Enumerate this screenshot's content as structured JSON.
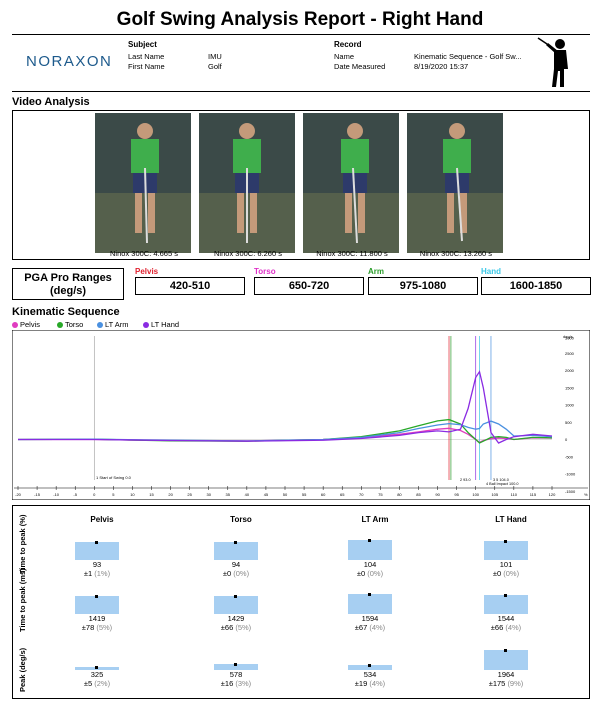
{
  "report": {
    "title": "Golf Swing Analysis Report - Right Hand",
    "logo": "NORAXON",
    "subject_heading": "Subject",
    "subject_last_name_label": "Last Name",
    "subject_last_name": "IMU",
    "subject_first_name_label": "First Name",
    "subject_first_name": "Golf",
    "record_heading": "Record",
    "record_name_label": "Name",
    "record_name": "Kinematic Sequence - Golf Sw...",
    "record_date_label": "Date Measured",
    "record_date": "8/19/2020 15:37"
  },
  "video": {
    "heading": "Video Analysis",
    "frames": [
      {
        "caption": "Ninox 300C: 4.665 s"
      },
      {
        "caption": "Ninox 300C: 6.260 s"
      },
      {
        "caption": "Ninox 300C: 11.800 s"
      },
      {
        "caption": "Ninox 300C: 13.260 s"
      }
    ]
  },
  "pga": {
    "title_line1": "PGA Pro Ranges",
    "title_line2": "(deg/s)",
    "ranges": [
      {
        "label": "Pelvis",
        "value": "420-510",
        "color": "#e0202e"
      },
      {
        "label": "Torso",
        "value": "650-720",
        "color": "#e030c8"
      },
      {
        "label": "Arm",
        "value": "975-1080",
        "color": "#2a9d2a"
      },
      {
        "label": "Hand",
        "value": "1600-1850",
        "color": "#38c8e8"
      }
    ]
  },
  "kinematic": {
    "heading": "Kinematic Sequence",
    "legend": [
      {
        "name": "Pelvis",
        "color": "#e03cc0"
      },
      {
        "name": "Torso",
        "color": "#28a828"
      },
      {
        "name": "LT Arm",
        "color": "#4a90e0"
      },
      {
        "name": "LT Hand",
        "color": "#8a2be2"
      }
    ],
    "unit_label": "deg/s",
    "x_unit": "%",
    "marker_start": "1 Start of Swing 0.0",
    "marker_2": "2  93.0",
    "marker_3": "3  5  104.0",
    "marker_impact": "4  Ball Impact 100.0"
  },
  "chart_data": {
    "type": "line",
    "xlabel": "",
    "ylabel": "deg/s",
    "xlim": [
      -20,
      120
    ],
    "ylim": [
      -1000,
      3000
    ],
    "x": [
      -20,
      0,
      20,
      40,
      60,
      70,
      80,
      85,
      90,
      93,
      96,
      98,
      100,
      101,
      102,
      104,
      106,
      108,
      110,
      115,
      120
    ],
    "series": [
      {
        "name": "Pelvis",
        "values": [
          0,
          0,
          -30,
          -40,
          0,
          60,
          150,
          220,
          300,
          325,
          260,
          150,
          0,
          -80,
          -30,
          20,
          40,
          30,
          0,
          50,
          40
        ]
      },
      {
        "name": "Torso",
        "values": [
          0,
          10,
          -40,
          -50,
          0,
          80,
          250,
          400,
          540,
          578,
          450,
          200,
          0,
          -100,
          -50,
          60,
          80,
          60,
          0,
          60,
          50
        ]
      },
      {
        "name": "LT Arm",
        "values": [
          0,
          10,
          -20,
          -40,
          0,
          60,
          200,
          320,
          420,
          460,
          430,
          350,
          300,
          320,
          450,
          534,
          450,
          300,
          100,
          120,
          80
        ]
      },
      {
        "name": "LT Hand",
        "values": [
          0,
          0,
          -30,
          -50,
          -20,
          30,
          120,
          200,
          250,
          220,
          300,
          900,
          1800,
          1964,
          1500,
          200,
          -100,
          0,
          80,
          150,
          100
        ]
      }
    ],
    "x_ticks": [
      "-20",
      "-15",
      "-10",
      "-5",
      "0",
      "5",
      "10",
      "15",
      "20",
      "25",
      "30",
      "35",
      "40",
      "45",
      "50",
      "55",
      "60",
      "65",
      "70",
      "75",
      "80",
      "85",
      "90",
      "95",
      "100",
      "105",
      "110",
      "115",
      "120"
    ],
    "y_ticks": [
      "3000",
      "2500",
      "2000",
      "1500",
      "1000",
      "500",
      "0",
      "-500",
      "-1000",
      "-1500"
    ]
  },
  "stats": {
    "columns": [
      "Pelvis",
      "Torso",
      "LT Arm",
      "LT Hand"
    ],
    "rows": [
      {
        "label": "Time to peak (%)",
        "cells": [
          {
            "mean": "93",
            "sd": "±1",
            "pct": "(1%)",
            "frac": 0.89
          },
          {
            "mean": "94",
            "sd": "±0",
            "pct": "(0%)",
            "frac": 0.9
          },
          {
            "mean": "104",
            "sd": "±0",
            "pct": "(0%)",
            "frac": 1.0
          },
          {
            "mean": "101",
            "sd": "±0",
            "pct": "(0%)",
            "frac": 0.97
          }
        ]
      },
      {
        "label": "Time to peak (ms)",
        "cells": [
          {
            "mean": "1419",
            "sd": "±78",
            "pct": "(5%)",
            "frac": 0.89
          },
          {
            "mean": "1429",
            "sd": "±66",
            "pct": "(5%)",
            "frac": 0.9
          },
          {
            "mean": "1594",
            "sd": "±67",
            "pct": "(4%)",
            "frac": 1.0
          },
          {
            "mean": "1544",
            "sd": "±66",
            "pct": "(4%)",
            "frac": 0.97
          }
        ]
      },
      {
        "label": "Peak (deg/s)",
        "cells": [
          {
            "mean": "325",
            "sd": "±5",
            "pct": "(2%)",
            "frac": 0.17
          },
          {
            "mean": "578",
            "sd": "±16",
            "pct": "(3%)",
            "frac": 0.29
          },
          {
            "mean": "534",
            "sd": "±19",
            "pct": "(4%)",
            "frac": 0.27
          },
          {
            "mean": "1964",
            "sd": "±175",
            "pct": "(9%)",
            "frac": 1.0
          }
        ]
      }
    ]
  }
}
